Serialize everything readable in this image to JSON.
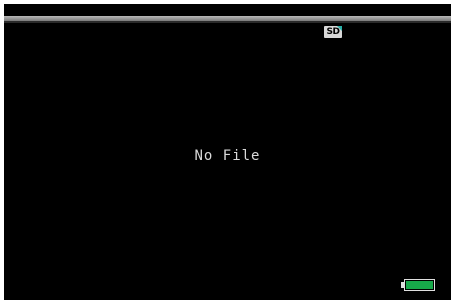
{
  "screen": {
    "storage_badge": "SD",
    "storage_icon": "sd-card-icon",
    "message": "No File",
    "battery_icon": "battery-icon",
    "battery_level": 1.0
  },
  "colors": {
    "background": "#000000",
    "text": "#d9d9d9",
    "battery_fill": "#17a84a",
    "sd_accent": "#2bb0a8"
  }
}
